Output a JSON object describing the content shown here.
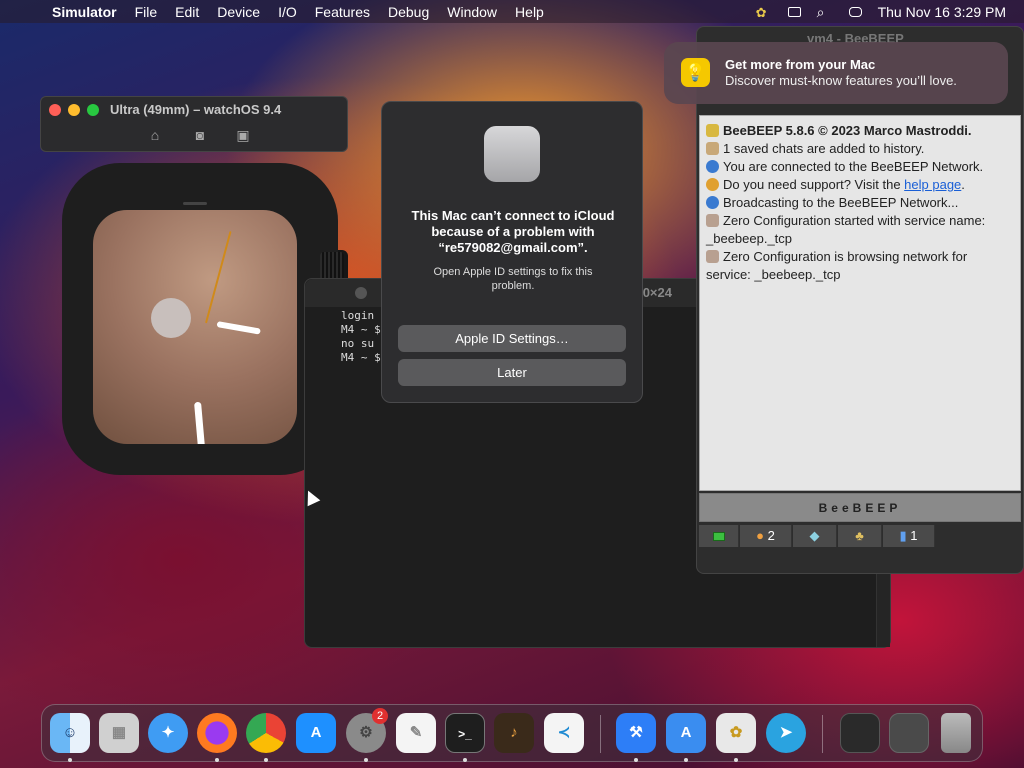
{
  "menubar": {
    "app_name": "Simulator",
    "items": [
      "File",
      "Edit",
      "Device",
      "I/O",
      "Features",
      "Debug",
      "Window",
      "Help"
    ],
    "datetime": "Thu Nov 16  3:29 PM"
  },
  "simulator": {
    "title": "Ultra (49mm) – watchOS 9.4"
  },
  "terminal": {
    "size_label": "0×24",
    "lines": [
      "login",
      "M4 ~ $",
      " no su",
      "M4 ~ $"
    ]
  },
  "alert": {
    "title": "This Mac can’t connect to iCloud because of a problem with “re579082@gmail.com”.",
    "message": "Open Apple ID settings to fix this problem.",
    "primary_button": "Apple ID Settings…",
    "secondary_button": "Later"
  },
  "notification": {
    "title": "Get more from your Mac",
    "body": "Discover must-know features you’ll love."
  },
  "beebeep": {
    "window_title": "vm4 - BeeBEEP",
    "lines": [
      "BeeBEEP 5.8.6 © 2023 Marco Mastroddi.",
      "1 saved chats are added to history.",
      "You are connected to the BeeBEEP Network.",
      "Do you need support? Visit the",
      "help page",
      ".",
      "Broadcasting to the BeeBEEP Network...",
      "Zero Configuration started with service name:",
      "_beebeep._tcp",
      "Zero Configuration is browsing network for",
      "service: _beebeep._tcp"
    ],
    "banner": "BeeBEEP",
    "tabs": [
      "",
      "2",
      "",
      "",
      "1"
    ]
  },
  "dock": {
    "settings_badge": "2"
  },
  "colors": {
    "alert_button": "#5a5a5c",
    "link": "#1a5fd6",
    "notification_icon": "#f5c800",
    "badge": "#e03030"
  }
}
